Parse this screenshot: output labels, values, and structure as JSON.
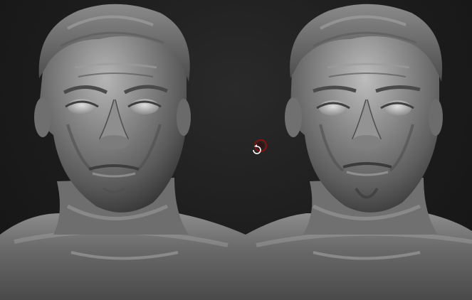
{
  "viewport": {
    "background_color": "#1c1c1c",
    "material_color": "#6b6b6b"
  },
  "models": [
    {
      "id": "left",
      "description_name": "sculpt-bust-left"
    },
    {
      "id": "right",
      "description_name": "sculpt-bust-right"
    }
  ],
  "cursor": {
    "icon": "rotate-cursor-icon",
    "ring_color": "#8a1010"
  }
}
